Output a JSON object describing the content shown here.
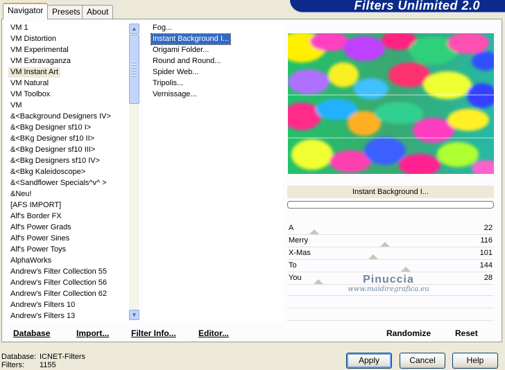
{
  "tabs": [
    {
      "label": "Navigator",
      "active": true
    },
    {
      "label": "Presets",
      "active": false
    },
    {
      "label": "About",
      "active": false
    }
  ],
  "brand_title": "Filters Unlimited 2.0",
  "categories": [
    {
      "label": "VM 1"
    },
    {
      "label": "VM Distortion"
    },
    {
      "label": "VM Experimental"
    },
    {
      "label": "VM Extravaganza"
    },
    {
      "label": "VM Instant Art",
      "selected": true
    },
    {
      "label": "VM Natural"
    },
    {
      "label": "VM Toolbox"
    },
    {
      "label": "VM"
    },
    {
      "label": "&<Background Designers IV>"
    },
    {
      "label": "&<Bkg Designer sf10 I>"
    },
    {
      "label": "&<BKg Designer sf10 II>"
    },
    {
      "label": "&<Bkg Designer sf10 III>"
    },
    {
      "label": "&<Bkg Designers sf10 IV>"
    },
    {
      "label": "&<Bkg Kaleidoscope>"
    },
    {
      "label": "&<Sandflower Specials^v^ >"
    },
    {
      "label": "&Neu!"
    },
    {
      "label": "[AFS IMPORT]"
    },
    {
      "label": "Alf's Border FX"
    },
    {
      "label": "Alf's Power Grads"
    },
    {
      "label": "Alf's Power Sines"
    },
    {
      "label": "Alf's Power Toys"
    },
    {
      "label": "AlphaWorks"
    },
    {
      "label": "Andrew's Filter Collection 55"
    },
    {
      "label": "Andrew's Filter Collection 56"
    },
    {
      "label": "Andrew's Filter Collection 62"
    },
    {
      "label": "Andrew's Filters 10"
    },
    {
      "label": "Andrew's Filters 13"
    }
  ],
  "filters": [
    {
      "label": "Fog..."
    },
    {
      "label": "Instant Background I...",
      "selected": true
    },
    {
      "label": "Origami Folder..."
    },
    {
      "label": "Round and Round..."
    },
    {
      "label": "Spider Web..."
    },
    {
      "label": "Tripolis..."
    },
    {
      "label": "Vernissage..."
    }
  ],
  "preview_caption": "Instant Background I...",
  "parameters": [
    {
      "name": "A",
      "value": "22",
      "level": 0.086
    },
    {
      "name": "Merry",
      "value": "116",
      "level": 0.455
    },
    {
      "name": "X-Mas",
      "value": "101",
      "level": 0.396
    },
    {
      "name": "To",
      "value": "144",
      "level": 0.565
    },
    {
      "name": "You",
      "value": "28",
      "level": 0.11
    }
  ],
  "watermark": {
    "name": "Pinuccia",
    "url": "www.maidiregrafica.eu"
  },
  "panel_buttons": {
    "database": "Database",
    "import": "Import...",
    "filter_info": "Filter Info...",
    "editor": "Editor...",
    "randomize": "Randomize",
    "reset": "Reset"
  },
  "status": {
    "database_label": "Database:",
    "database_value": "ICNET-Filters",
    "filters_label": "Filters:",
    "filters_value": "1155"
  },
  "dialog_buttons": {
    "apply": "Apply",
    "cancel": "Cancel",
    "help": "Help"
  },
  "icons": {
    "scroll_up": "arrow-up-icon",
    "scroll_down": "arrow-down-icon"
  },
  "colors": {
    "selection": "#316ac5",
    "brand_bg": "#0b2a8a",
    "window_bg": "#ece9d8"
  }
}
